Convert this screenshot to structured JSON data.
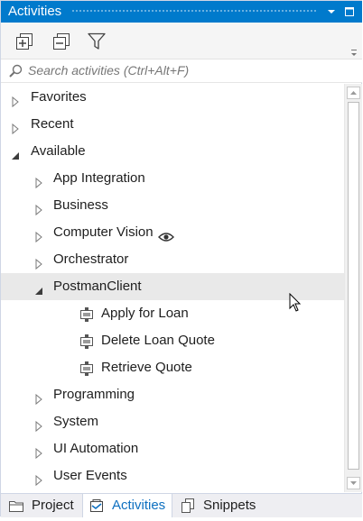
{
  "panel": {
    "title": "Activities"
  },
  "toolbar": {
    "expand_all_icon": "expand-all-icon",
    "collapse_all_icon": "collapse-all-icon",
    "filter_icon": "filter-icon"
  },
  "search": {
    "placeholder": "Search activities (Ctrl+Alt+F)",
    "value": ""
  },
  "tree": {
    "favorites": "Favorites",
    "recent": "Recent",
    "available": "Available",
    "app_integration": "App Integration",
    "business": "Business",
    "computer_vision": "Computer Vision",
    "orchestrator": "Orchestrator",
    "postman_client": "PostmanClient",
    "apply_for_loan": "Apply for Loan",
    "delete_loan_quote": "Delete Loan Quote",
    "retrieve_quote": "Retrieve Quote",
    "programming": "Programming",
    "system": "System",
    "ui_automation": "UI Automation",
    "user_events": "User Events"
  },
  "tabs": {
    "project": "Project",
    "activities": "Activities",
    "snippets": "Snippets"
  },
  "colors": {
    "title_bar": "#007acc",
    "active_tab_text": "#0e70c0",
    "selected_row": "#e9e9e9"
  }
}
